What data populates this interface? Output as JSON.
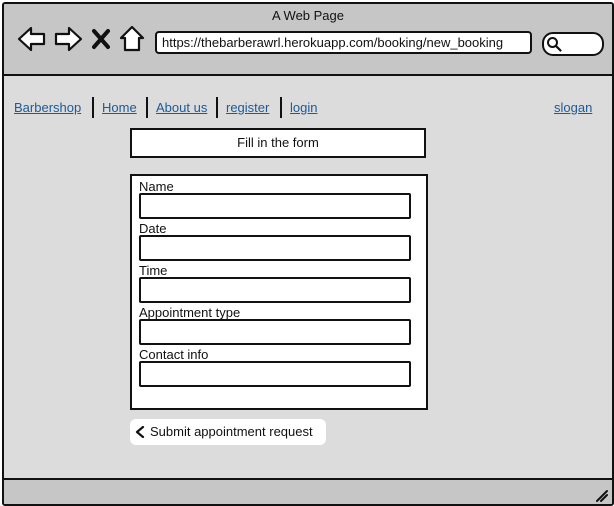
{
  "window": {
    "title": "A Web Page"
  },
  "browser": {
    "url": "https://thebarberawrl.herokuapp.com/booking/new_booking",
    "icons": [
      "back-arrow-icon",
      "forward-arrow-icon",
      "close-x-icon",
      "home-icon",
      "search-icon"
    ]
  },
  "nav": {
    "brand": "Barbershop",
    "links": [
      "Home",
      "About us",
      "register",
      "login"
    ],
    "slogan": "slogan"
  },
  "page": {
    "heading": "Fill in the form"
  },
  "form": {
    "fields": [
      {
        "label": "Name",
        "value": ""
      },
      {
        "label": "Date",
        "value": ""
      },
      {
        "label": "Time",
        "value": ""
      },
      {
        "label": "Appointment type",
        "value": ""
      },
      {
        "label": "Contact info",
        "value": ""
      }
    ],
    "submit_label": "Submit appointment request"
  },
  "colors": {
    "link": "#1c5a99",
    "chrome": "#c6c6c6",
    "page": "#dcdcdc"
  }
}
